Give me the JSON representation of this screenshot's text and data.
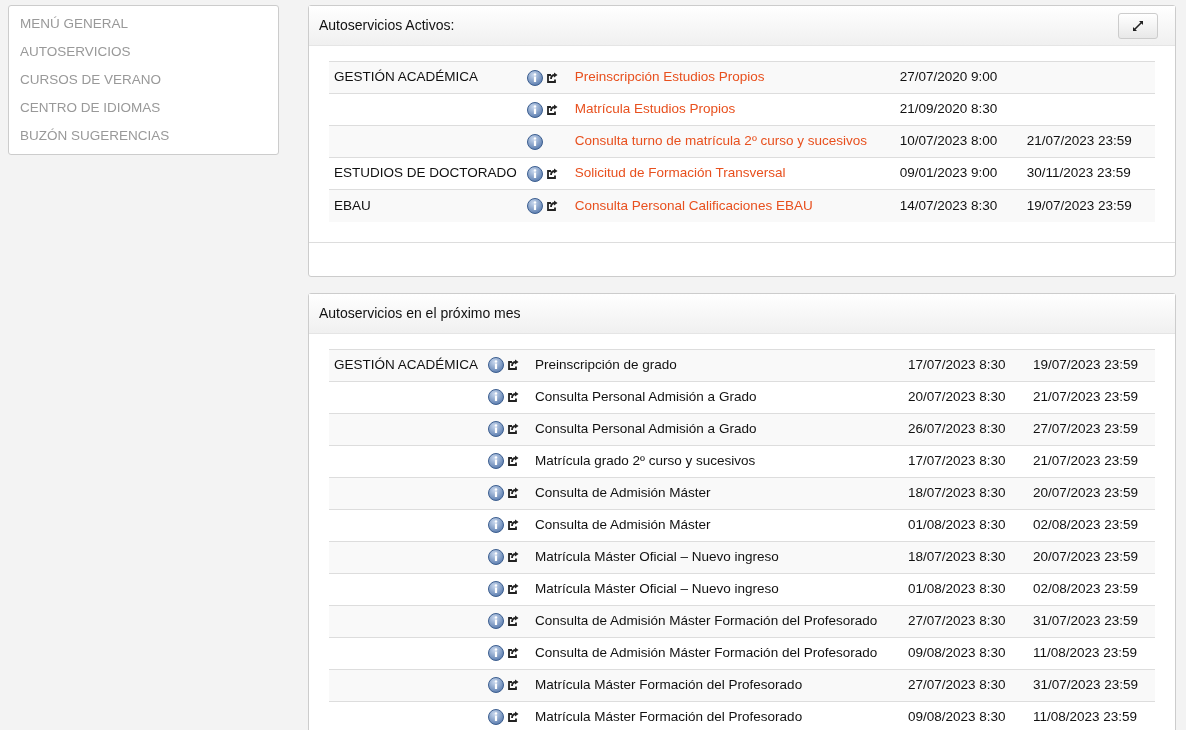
{
  "sidebar": {
    "items": [
      {
        "label": "MENÚ GENERAL"
      },
      {
        "label": "AUTOSERVICIOS"
      },
      {
        "label": "CURSOS DE VERANO"
      },
      {
        "label": "CENTRO DE IDIOMAS"
      },
      {
        "label": "BUZÓN SUGERENCIAS"
      }
    ]
  },
  "panels": [
    {
      "title": "Autoservicios Activos:",
      "expand_button": true,
      "linked": true,
      "footer": true,
      "rows": [
        {
          "category": "GESTIÓN ACADÉMICA",
          "launch": true,
          "name": "Preinscripción Estudios Propios",
          "start": "27/07/2020 9:00",
          "end": ""
        },
        {
          "category": "",
          "launch": true,
          "name": "Matrícula Estudios Propios",
          "start": "21/09/2020 8:30",
          "end": ""
        },
        {
          "category": "",
          "launch": false,
          "name": "Consulta turno de matrícula 2º curso y sucesivos",
          "start": "10/07/2023 8:00",
          "end": "21/07/2023 23:59"
        },
        {
          "category": "ESTUDIOS DE DOCTORADO",
          "launch": true,
          "name": "Solicitud de Formación Transversal",
          "start": "09/01/2023 9:00",
          "end": "30/11/2023 23:59"
        },
        {
          "category": "EBAU",
          "launch": true,
          "name": "Consulta Personal Calificaciones EBAU",
          "start": "14/07/2023 8:30",
          "end": "19/07/2023 23:59"
        }
      ]
    },
    {
      "title": "Autoservicios en el próximo mes",
      "expand_button": false,
      "linked": false,
      "footer": false,
      "rows": [
        {
          "category": "GESTIÓN ACADÉMICA",
          "launch": true,
          "name": "Preinscripción de grado",
          "start": "17/07/2023 8:30",
          "end": "19/07/2023 23:59"
        },
        {
          "category": "",
          "launch": true,
          "name": "Consulta Personal Admisión a Grado",
          "start": "20/07/2023 8:30",
          "end": "21/07/2023 23:59"
        },
        {
          "category": "",
          "launch": true,
          "name": "Consulta Personal Admisión a Grado",
          "start": "26/07/2023 8:30",
          "end": "27/07/2023 23:59"
        },
        {
          "category": "",
          "launch": true,
          "name": "Matrícula grado 2º curso y sucesivos",
          "start": "17/07/2023 8:30",
          "end": "21/07/2023 23:59"
        },
        {
          "category": "",
          "launch": true,
          "name": "Consulta de Admisión Máster",
          "start": "18/07/2023 8:30",
          "end": "20/07/2023 23:59"
        },
        {
          "category": "",
          "launch": true,
          "name": "Consulta de Admisión Máster",
          "start": "01/08/2023 8:30",
          "end": "02/08/2023 23:59"
        },
        {
          "category": "",
          "launch": true,
          "name": "Matrícula Máster Oficial – Nuevo ingreso",
          "start": "18/07/2023 8:30",
          "end": "20/07/2023 23:59"
        },
        {
          "category": "",
          "launch": true,
          "name": "Matrícula Máster Oficial – Nuevo ingreso",
          "start": "01/08/2023 8:30",
          "end": "02/08/2023 23:59"
        },
        {
          "category": "",
          "launch": true,
          "name": "Consulta de Admisión Máster Formación del Profesorado",
          "start": "27/07/2023 8:30",
          "end": "31/07/2023 23:59"
        },
        {
          "category": "",
          "launch": true,
          "name": "Consulta de Admisión Máster Formación del Profesorado",
          "start": "09/08/2023 8:30",
          "end": "11/08/2023 23:59"
        },
        {
          "category": "",
          "launch": true,
          "name": "Matrícula Máster Formación del Profesorado",
          "start": "27/07/2023 8:30",
          "end": "31/07/2023 23:59"
        },
        {
          "category": "",
          "launch": true,
          "name": "Matrícula Máster Formación del Profesorado",
          "start": "09/08/2023 8:30",
          "end": "11/08/2023 23:59"
        }
      ]
    }
  ]
}
